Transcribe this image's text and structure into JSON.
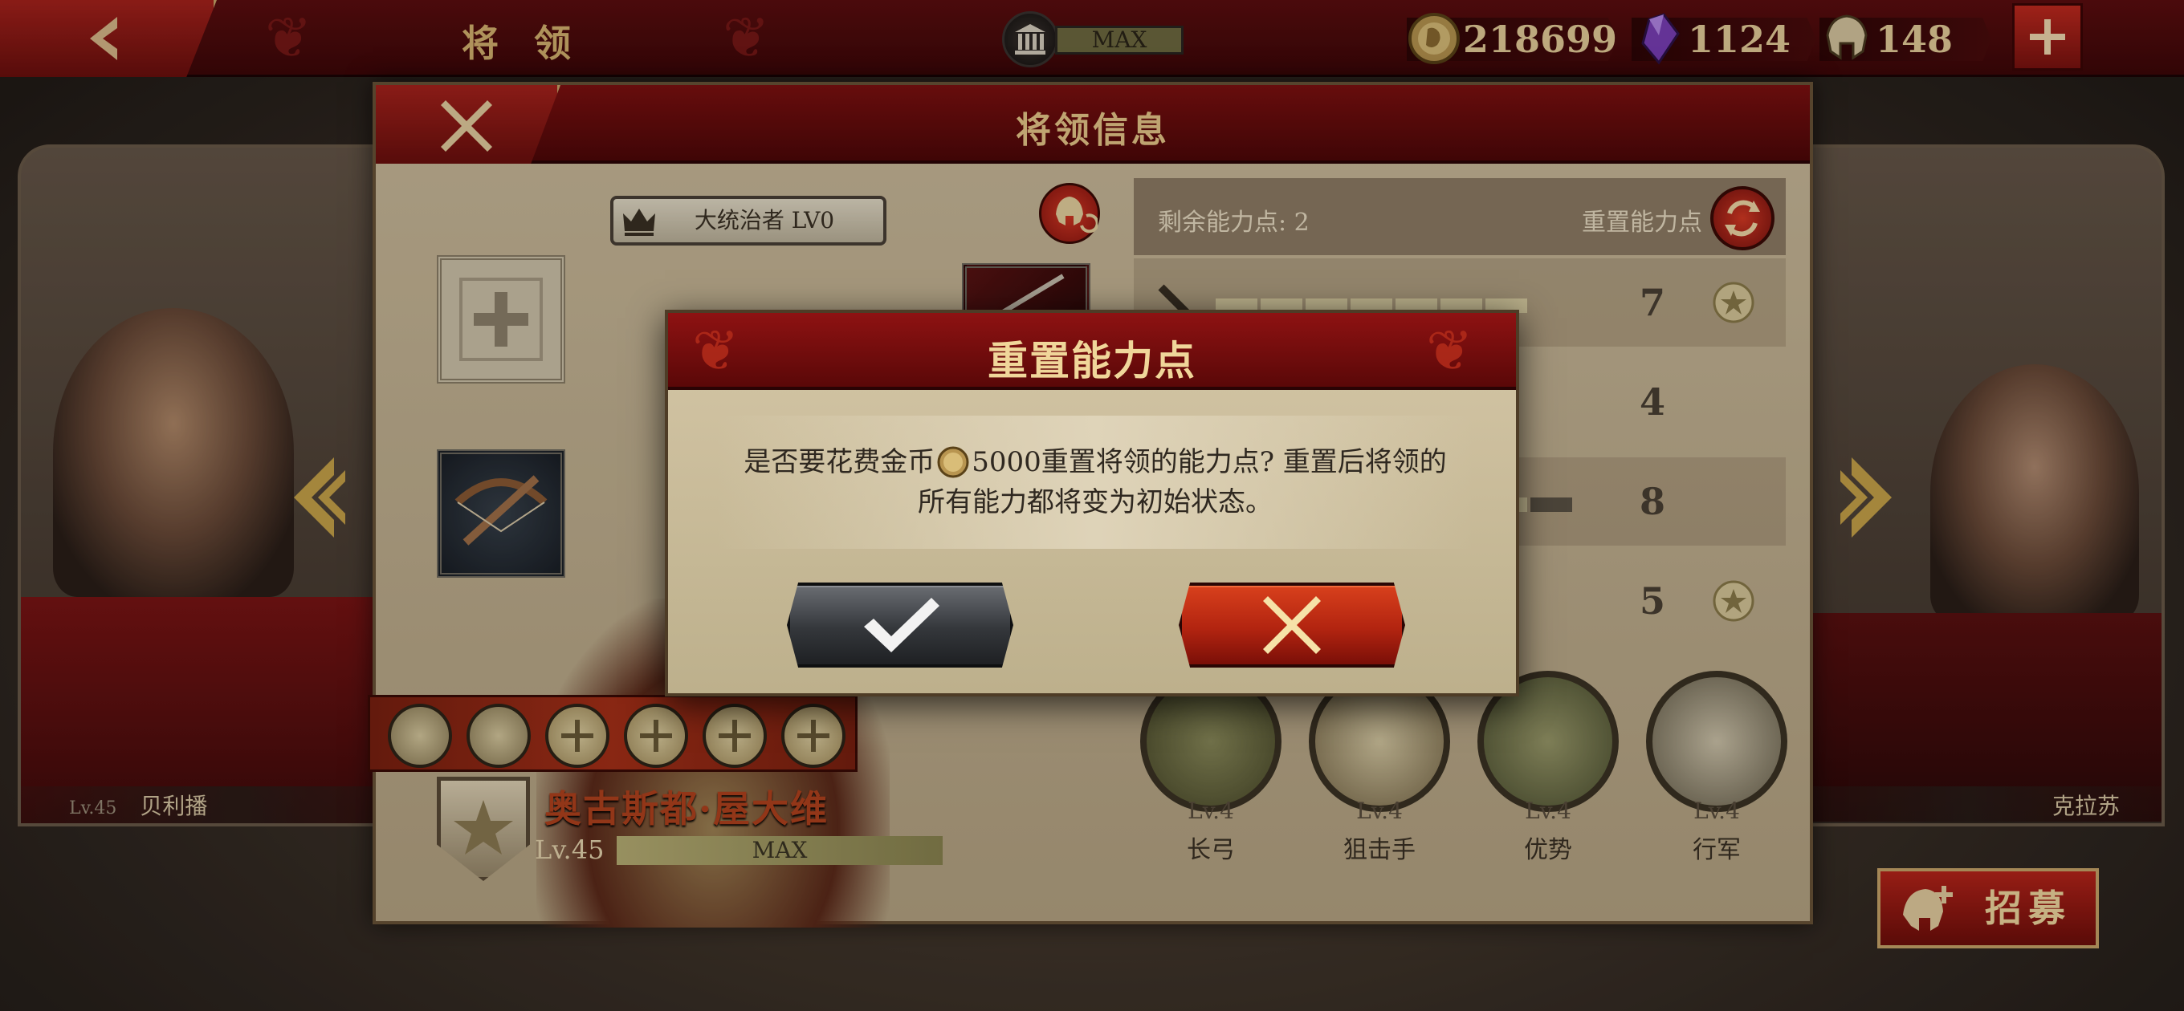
{
  "topbar": {
    "title": "将 领",
    "vip_label": "MAX",
    "gold": "218699",
    "gems": "1124",
    "tokens": "148"
  },
  "left_hero": {
    "level": "Lv.45",
    "name": "贝利播"
  },
  "right_hero": {
    "name": "克拉苏"
  },
  "panel": {
    "title": "将领信息",
    "title_badge": "大统治者 LV0",
    "remaining_points_label": "剩余能力点: 2",
    "reset_points_label": "重置能力点",
    "stats": [
      {
        "value": "7",
        "medal": true
      },
      {
        "value": "4",
        "medal": false
      },
      {
        "value": "8",
        "medal": false
      },
      {
        "value": "5",
        "medal": true
      }
    ],
    "skills": [
      {
        "level": "Lv.4",
        "name": "长弓"
      },
      {
        "level": "Lv.4",
        "name": "狙击手"
      },
      {
        "level": "Lv.4",
        "name": "优势"
      },
      {
        "level": "Lv.4",
        "name": "行军"
      }
    ],
    "hero": {
      "name": "奥古斯都·屋大维",
      "level": "Lv.45",
      "exp_label": "MAX"
    }
  },
  "dialog": {
    "title": "重置能力点",
    "line1_before": "是否要花费金币",
    "line1_after": "5000重置将领的能力点? 重置后将领的",
    "line2": "所有能力都将变为初始状态。",
    "confirm_icon": "check-icon",
    "cancel_icon": "close-icon"
  },
  "recruit": {
    "label": "招募"
  },
  "colors": {
    "brand_red": "#7e1010",
    "gold_text": "#e9c98a",
    "confirm_dark": "#34373b",
    "cancel_red": "#b22410"
  }
}
